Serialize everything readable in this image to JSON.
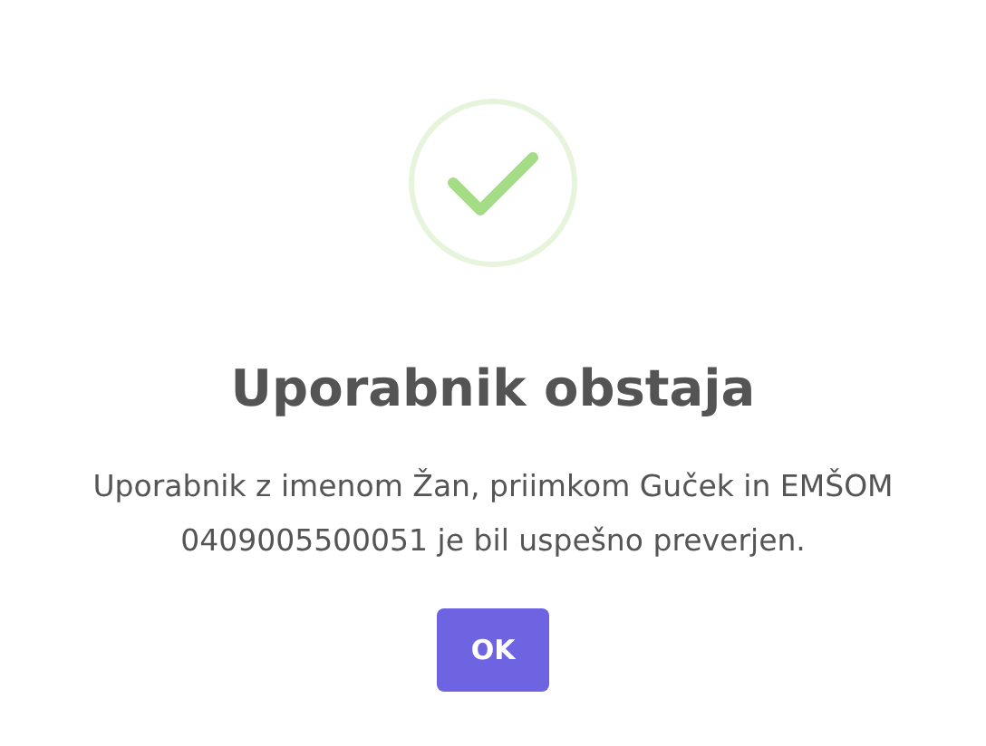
{
  "dialog": {
    "icon": {
      "kind": "success"
    },
    "title": "Uporabnik obstaja",
    "message": "Uporabnik z imenom Žan, priimkom Guček in EMŠOM 0409005500051 je bil uspešno preverjen.",
    "buttons": [
      "OK"
    ]
  }
}
